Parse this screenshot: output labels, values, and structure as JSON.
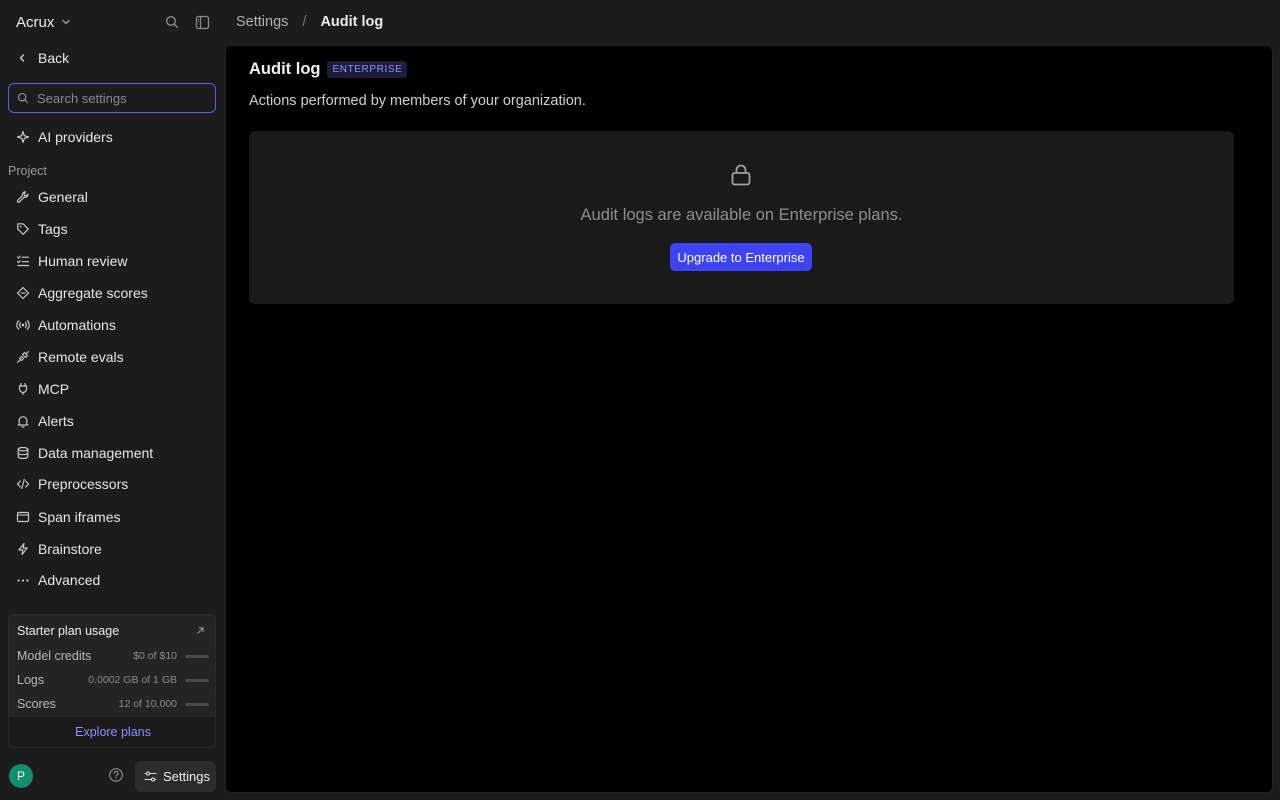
{
  "app": {
    "org_name": "Acrux"
  },
  "sidebar": {
    "back_label": "Back",
    "search": {
      "placeholder": "Search settings",
      "value": ""
    },
    "ai_providers_label": "AI providers",
    "section_label": "Project",
    "items": [
      {
        "label": "General",
        "icon": "wrench-icon"
      },
      {
        "label": "Tags",
        "icon": "tag-icon"
      },
      {
        "label": "Human review",
        "icon": "checklist-icon"
      },
      {
        "label": "Aggregate scores",
        "icon": "diamond-icon"
      },
      {
        "label": "Automations",
        "icon": "broadcast-icon"
      },
      {
        "label": "Remote evals",
        "icon": "plug-connection-icon"
      },
      {
        "label": "MCP",
        "icon": "plug-icon"
      },
      {
        "label": "Alerts",
        "icon": "bell-icon"
      },
      {
        "label": "Data management",
        "icon": "database-icon"
      },
      {
        "label": "Preprocessors",
        "icon": "code-icon"
      },
      {
        "label": "Span iframes",
        "icon": "window-icon"
      },
      {
        "label": "Brainstore",
        "icon": "lightning-icon"
      },
      {
        "label": "Advanced",
        "icon": "ellipsis-icon"
      }
    ],
    "usage": {
      "title": "Starter plan usage",
      "rows": [
        {
          "label": "Model credits",
          "value": "$0 of $10",
          "fraction": 0
        },
        {
          "label": "Logs",
          "value": "0.0002 GB of 1 GB",
          "fraction": 0.0002
        },
        {
          "label": "Scores",
          "value": "12 of 10,000",
          "fraction": 0.0012
        }
      ],
      "explore_label": "Explore plans"
    },
    "avatar_initial": "P",
    "settings_label": "Settings"
  },
  "header": {
    "breadcrumb_parent": "Settings",
    "breadcrumb_separator": "/",
    "breadcrumb_current": "Audit log"
  },
  "main": {
    "title": "Audit log",
    "badge": "ENTERPRISE",
    "description": "Actions performed by members of your organization.",
    "locked_message": "Audit logs are available on Enterprise plans.",
    "upgrade_label": "Upgrade to Enterprise"
  },
  "colors": {
    "accent": "#3e44f3",
    "focus_ring": "#5b5ee8",
    "link": "#8f92ff",
    "avatar": "#138f6e"
  }
}
